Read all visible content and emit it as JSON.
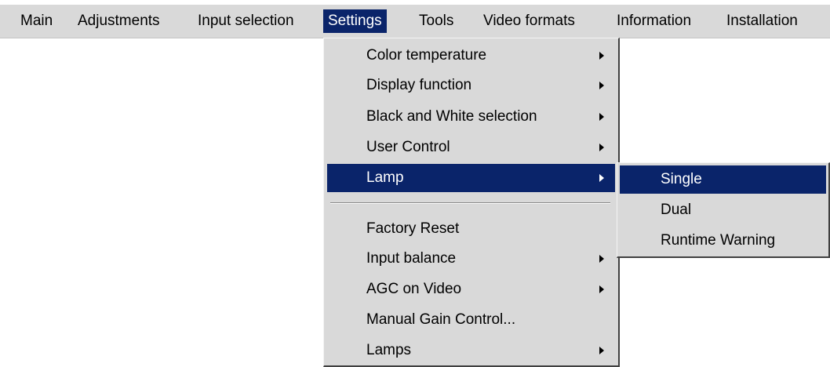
{
  "menubar": {
    "items": [
      {
        "label": "Main"
      },
      {
        "label": "Adjustments"
      },
      {
        "label": "Input selection"
      },
      {
        "label": "Settings"
      },
      {
        "label": "Tools"
      },
      {
        "label": "Video formats"
      },
      {
        "label": "Information"
      },
      {
        "label": "Installation"
      }
    ],
    "active": "Settings"
  },
  "settings_menu": {
    "items": [
      {
        "label": "Color temperature",
        "has_submenu": true
      },
      {
        "label": "Display function",
        "has_submenu": true
      },
      {
        "label": "Black and White selection",
        "has_submenu": true
      },
      {
        "label": "User Control",
        "has_submenu": true
      },
      {
        "label": "Lamp",
        "has_submenu": true,
        "highlighted": true
      },
      {
        "label": "Factory Reset",
        "has_submenu": false
      },
      {
        "label": "Input balance",
        "has_submenu": true
      },
      {
        "label": "AGC on Video",
        "has_submenu": true
      },
      {
        "label": "Manual Gain Control...",
        "has_submenu": false
      },
      {
        "label": "Lamps",
        "has_submenu": true
      }
    ]
  },
  "lamp_submenu": {
    "items": [
      {
        "label": "Single",
        "highlighted": true
      },
      {
        "label": "Dual"
      },
      {
        "label": "Runtime Warning"
      }
    ]
  },
  "colors": {
    "menu_background": "#d9d9d9",
    "highlight": "#0a246a",
    "highlight_text": "#ffffff"
  }
}
